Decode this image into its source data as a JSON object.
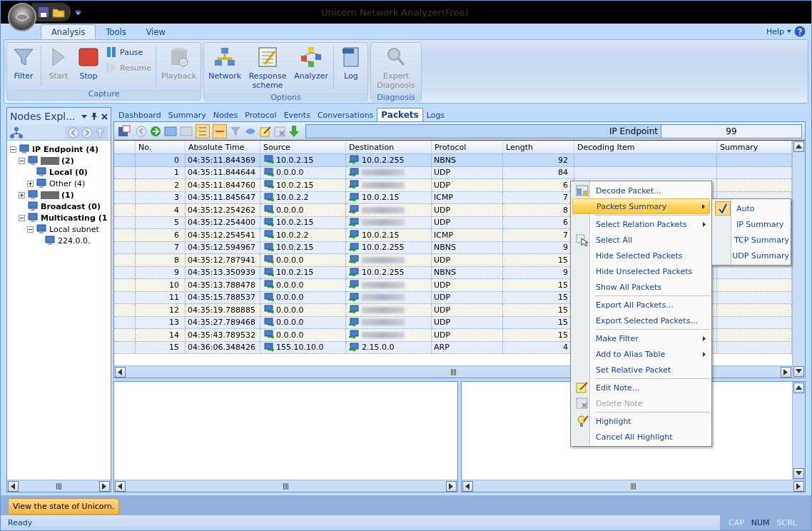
{
  "window": {
    "title": "Unicorn Network Analyzer(Free)"
  },
  "ribbon_tabs": [
    {
      "label": "Analysis",
      "selected": true
    },
    {
      "label": "Tools",
      "selected": false
    },
    {
      "label": "View",
      "selected": false
    }
  ],
  "help": "Help",
  "ribbon_groups": [
    {
      "title": "Capture",
      "buttons": [
        {
          "kind": "large",
          "label": "Filter",
          "disabled": false
        },
        {
          "kind": "large",
          "label": "Start",
          "disabled": true
        },
        {
          "kind": "large",
          "label": "Stop",
          "disabled": false
        },
        {
          "kind": "stack",
          "items": [
            {
              "label": "Pause",
              "disabled": false
            },
            {
              "label": "Resume",
              "disabled": true
            }
          ]
        },
        {
          "kind": "large",
          "label": "Playback",
          "disabled": true
        }
      ]
    },
    {
      "title": "Options",
      "buttons": [
        {
          "kind": "large",
          "label": "Network",
          "disabled": false
        },
        {
          "kind": "large",
          "label": "Response scheme",
          "disabled": false
        },
        {
          "kind": "large",
          "label": "Analyzer",
          "disabled": false
        },
        {
          "kind": "large",
          "label": "Log",
          "disabled": false
        }
      ]
    },
    {
      "title": "Diagnosis",
      "buttons": [
        {
          "kind": "large",
          "label": "Expert Diagnosis",
          "disabled": true
        }
      ]
    }
  ],
  "nodes_panel": {
    "title": "Nodes Expl...",
    "tree": [
      {
        "label": "IP Endpoint (4)",
        "bold": true,
        "redacted": false,
        "expanded": true,
        "children": [
          {
            "label": "(2)",
            "bold": true,
            "redacted": true,
            "expanded": true,
            "children": [
              {
                "label": "Local (0)",
                "bold": true,
                "redacted": false
              },
              {
                "label": "Other (4)",
                "bold": false,
                "redacted": false,
                "expanded": false
              }
            ]
          },
          {
            "label": "(1)",
            "bold": true,
            "redacted": true,
            "expanded": false
          },
          {
            "label": "Broadcast (0)",
            "bold": true,
            "redacted": false
          },
          {
            "label": "Multicasting (1",
            "bold": true,
            "redacted": false,
            "expanded": true,
            "children": [
              {
                "label": "Local subnet",
                "bold": false,
                "redacted": false,
                "expanded": true,
                "children": [
                  {
                    "label": "224.0.0.",
                    "bold": false,
                    "redacted": false
                  }
                ]
              }
            ]
          }
        ]
      }
    ]
  },
  "view_tabs": [
    {
      "label": "Dashboard",
      "selected": false
    },
    {
      "label": "Summary",
      "selected": false
    },
    {
      "label": "Nodes",
      "selected": false
    },
    {
      "label": "Protocol",
      "selected": false
    },
    {
      "label": "Events",
      "selected": false
    },
    {
      "label": "Conversations",
      "selected": false
    },
    {
      "label": "Packets",
      "selected": true
    },
    {
      "label": "Logs",
      "selected": false
    }
  ],
  "endpoint": {
    "label": "IP Endpoint",
    "value": "99"
  },
  "table": {
    "columns": [
      "No.",
      "Absolute Time",
      "Source",
      "Destination",
      "Protocol",
      "Length",
      "Decoding Item",
      "Summary"
    ],
    "rows": [
      {
        "no": "0",
        "time": "04:35:11.844369",
        "source": "10.0.2.15",
        "destination": "10.0.2.255",
        "protocol": "NBNS",
        "length": "92",
        "selected": true
      },
      {
        "no": "1",
        "time": "04:35:11.844644",
        "source": "0.0.0.0",
        "protocol": "UDP",
        "length": "84",
        "selected": false
      },
      {
        "no": "2",
        "time": "04:35:11.844760",
        "source": "10.0.2.15",
        "protocol": "UDP",
        "length": "6",
        "selected": false
      },
      {
        "no": "3",
        "time": "04:35:11.845647",
        "source": "10.0.2.2",
        "destination": "10.0.2.15",
        "protocol": "ICMP",
        "length": "7",
        "selected": false
      },
      {
        "no": "4",
        "time": "04:35:12.254262",
        "source": "0.0.0.0",
        "protocol": "UDP",
        "length": "8",
        "selected": false
      },
      {
        "no": "5",
        "time": "04:35:12.254400",
        "source": "10.0.2.15",
        "protocol": "UDP",
        "length": "6",
        "selected": false
      },
      {
        "no": "6",
        "time": "04:35:12.254541",
        "source": "10.0.2.2",
        "destination": "10.0.2.15",
        "protocol": "ICMP",
        "length": "7",
        "selected": false
      },
      {
        "no": "7",
        "time": "04:35:12.594967",
        "source": "10.0.2.15",
        "destination": "10.0.2.255",
        "protocol": "NBNS",
        "length": "9",
        "selected": false
      },
      {
        "no": "8",
        "time": "04:35:12.787941",
        "source": "0.0.0.0",
        "protocol": "UDP",
        "length": "15",
        "selected": false
      },
      {
        "no": "9",
        "time": "04:35:13.350939",
        "source": "10.0.2.15",
        "destination": "10.0.2.255",
        "protocol": "NBNS",
        "length": "9",
        "selected": false
      },
      {
        "no": "10",
        "time": "04:35:13.788478",
        "source": "0.0.0.0",
        "protocol": "UDP",
        "length": "15",
        "selected": false
      },
      {
        "no": "11",
        "time": "04:35:15.788537",
        "source": "0.0.0.0",
        "protocol": "UDP",
        "length": "15",
        "selected": false
      },
      {
        "no": "12",
        "time": "04:35:19.788885",
        "source": "0.0.0.0",
        "protocol": "UDP",
        "length": "15",
        "selected": false
      },
      {
        "no": "13",
        "time": "04:35:27.789468",
        "source": "0.0.0.0",
        "protocol": "UDP",
        "length": "15",
        "selected": false
      },
      {
        "no": "14",
        "time": "04:35:43.789532",
        "source": "0.0.0.0",
        "protocol": "UDP",
        "length": "15",
        "selected": false
      },
      {
        "no": "15",
        "time": "04:36:06.348426",
        "source": "155.10.10.0",
        "destination": "2.15.0.0",
        "protocol": "ARP",
        "length": "4",
        "selected": false
      }
    ]
  },
  "context_menu": [
    {
      "kind": "item",
      "label": "Decode Packet...",
      "selected": false,
      "disabled": false
    },
    {
      "kind": "submenu",
      "label": "Packets Summary",
      "selected": true,
      "disabled": false
    },
    {
      "kind": "separator"
    },
    {
      "kind": "submenu",
      "label": "Select Relation Packets",
      "selected": false,
      "disabled": false
    },
    {
      "kind": "item",
      "label": "Select All",
      "selected": false,
      "disabled": false
    },
    {
      "kind": "item",
      "label": "Hide Selected Packets",
      "selected": false,
      "disabled": false
    },
    {
      "kind": "item",
      "label": "Hide Unselected Packets",
      "selected": false,
      "disabled": false
    },
    {
      "kind": "item",
      "label": "Show All Packets",
      "selected": false,
      "disabled": false
    },
    {
      "kind": "separator"
    },
    {
      "kind": "item",
      "label": "Export All Packets...",
      "selected": false,
      "disabled": false
    },
    {
      "kind": "item",
      "label": "Export Selected Packets...",
      "selected": false,
      "disabled": false
    },
    {
      "kind": "separator"
    },
    {
      "kind": "submenu",
      "label": "Make Filter",
      "selected": false,
      "disabled": false
    },
    {
      "kind": "submenu",
      "label": "Add to Alias Table",
      "selected": false,
      "disabled": false
    },
    {
      "kind": "item",
      "label": "Set Relative Packet",
      "selected": false,
      "disabled": false
    },
    {
      "kind": "separator"
    },
    {
      "kind": "item",
      "label": "Edit Note...",
      "selected": false,
      "disabled": false
    },
    {
      "kind": "item",
      "label": "Delete Note",
      "selected": false,
      "disabled": true
    },
    {
      "kind": "separator"
    },
    {
      "kind": "item",
      "label": "Highlight",
      "selected": false,
      "disabled": false
    },
    {
      "kind": "item",
      "label": "Cancel All Highlight",
      "selected": false,
      "disabled": false
    }
  ],
  "submenu": [
    {
      "label": "Auto",
      "checked": true
    },
    {
      "label": "IP Summary",
      "checked": false
    },
    {
      "label": "TCP Summary",
      "checked": false
    },
    {
      "label": "UDP Summary",
      "checked": false
    }
  ],
  "bottom_tab": "View the state of Unicorn.",
  "status_bar": {
    "text": "Ready",
    "indicators": [
      {
        "label": "CAP",
        "on": false
      },
      {
        "label": "NUM",
        "on": true
      },
      {
        "label": "SCRL",
        "on": false
      }
    ]
  }
}
